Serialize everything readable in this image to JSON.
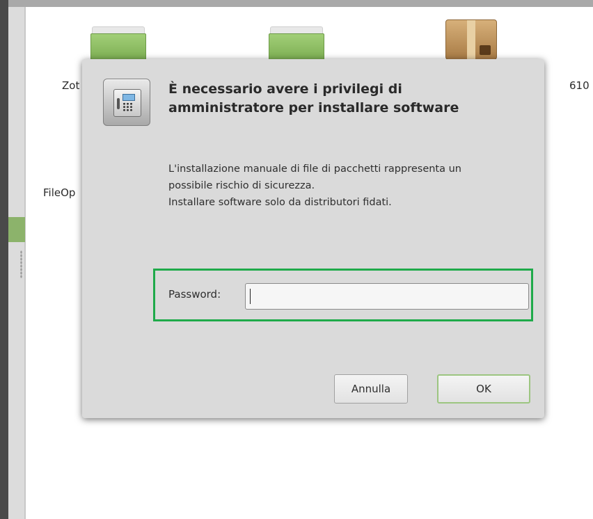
{
  "background": {
    "file_labels": [
      "Zot",
      "610",
      "FileOp"
    ]
  },
  "dialog": {
    "icon": "safe-lock-icon",
    "title_line1": "È necessario avere i privilegi di",
    "title_line2": "amministratore per installare software",
    "message_line1": "L'installazione manuale di file di pacchetti rappresenta un",
    "message_line2": "possibile rischio di sicurezza.",
    "message_line3": "Installare software solo da distributori fidati.",
    "password_label": "Password:",
    "password_value": "",
    "cancel_label": "Annulla",
    "ok_label": "OK",
    "highlight_color": "#1faa4a"
  }
}
